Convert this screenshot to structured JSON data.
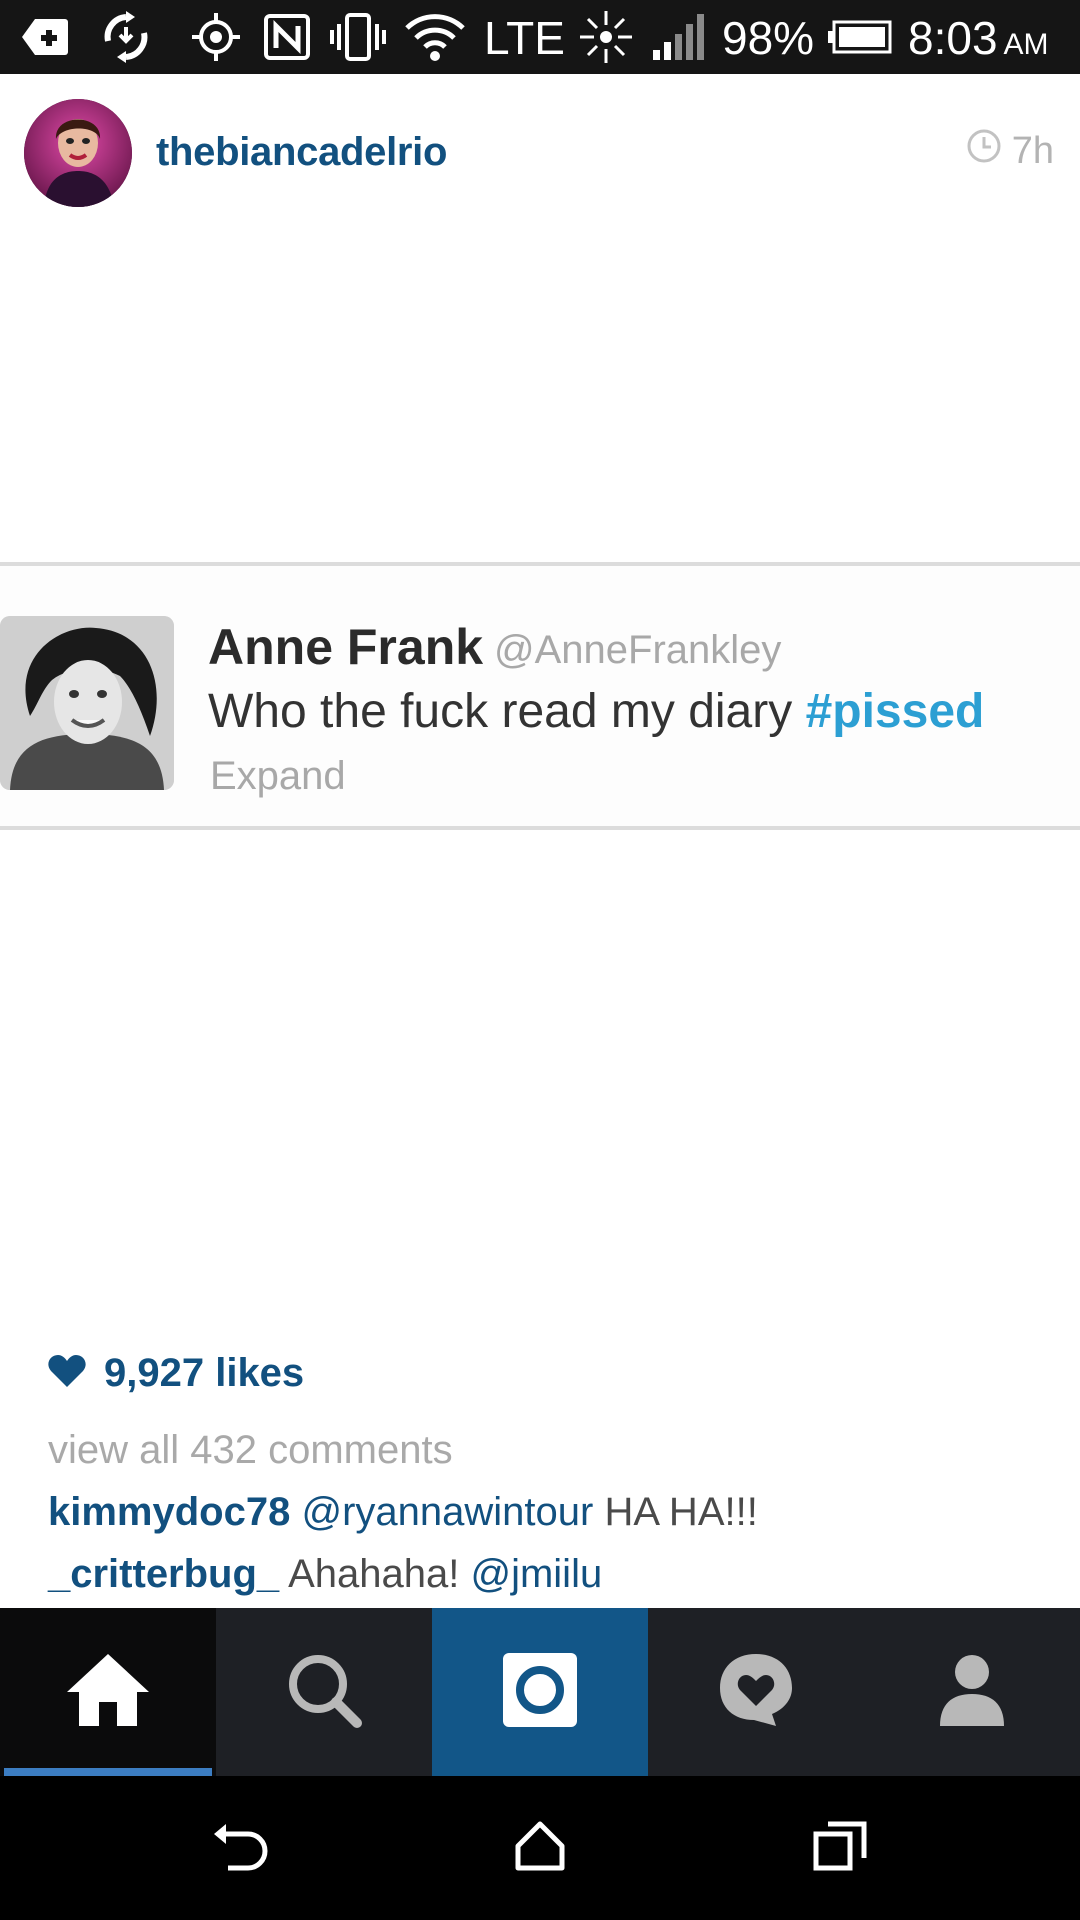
{
  "status_bar": {
    "network": "LTE",
    "battery": "98%",
    "time": "8:03",
    "ampm": "AM"
  },
  "post": {
    "username": "thebiancadelrio",
    "time_ago": "7h",
    "tweet": {
      "name": "Anne Frank",
      "handle": "@AnneFrankley",
      "text": "Who the fuck read my diary",
      "hashtag": "#pissed",
      "expand": "Expand"
    },
    "likes": "9,927 likes",
    "view_comments": "view all 432 comments",
    "comments": [
      {
        "user": "kimmydoc78",
        "mention": "@ryannawintour",
        "text": "HA HA!!!"
      },
      {
        "user": "_critterbug_",
        "text": "Ahahaha!",
        "mention": "@jmiilu"
      }
    ]
  },
  "tabs": [
    {
      "id": "home",
      "icon": "home-icon",
      "active": true
    },
    {
      "id": "search",
      "icon": "search-icon"
    },
    {
      "id": "camera",
      "icon": "camera-icon"
    },
    {
      "id": "activity",
      "icon": "activity-heart-icon"
    },
    {
      "id": "profile",
      "icon": "profile-icon"
    }
  ],
  "colors": {
    "brand_blue": "#12507f",
    "camera_tab": "#125688",
    "active_tab_line": "#3c7dc2",
    "hashtag": "#2c9fd3"
  }
}
